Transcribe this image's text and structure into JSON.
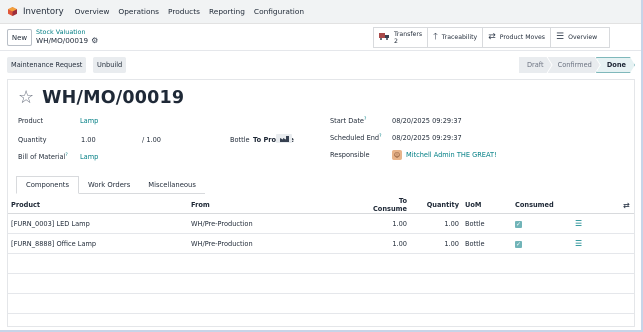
{
  "nav": {
    "brand": "Inventory",
    "items": [
      "Overview",
      "Operations",
      "Products",
      "Reporting",
      "Configuration"
    ]
  },
  "control": {
    "new_label": "New",
    "breadcrumb_parent": "Stock Valuation",
    "breadcrumb_current": "WH/MO/00019"
  },
  "smart_buttons": {
    "transfers_label": "Transfers",
    "transfers_count": "2",
    "traceability": "Traceability",
    "product_moves": "Product Moves",
    "overview": "Overview"
  },
  "status": {
    "maintenance": "Maintenance Request",
    "unbuild": "Unbuild",
    "steps": [
      "Draft",
      "Confirmed",
      "Done"
    ],
    "active_step": "Done"
  },
  "record": {
    "title": "WH/MO/00019",
    "product_label": "Product",
    "product_value": "Lamp",
    "quantity_label": "Quantity",
    "quantity_value": "1.00",
    "quantity_of": "/ 1.00",
    "bottle_text": "Bottle",
    "to_produce": "To Produce",
    "bom_label": "Bill of Material",
    "bom_value": "Lamp",
    "start_label": "Start Date",
    "start_value": "08/20/2025 09:29:37",
    "sched_label": "Scheduled End",
    "sched_value": "08/20/2025 09:29:37",
    "resp_label": "Responsible",
    "resp_value": "Mitchell Admin THE GREAT!",
    "help_mark": "?"
  },
  "tabs": [
    "Components",
    "Work Orders",
    "Miscellaneous"
  ],
  "table": {
    "headers": {
      "product": "Product",
      "from": "From",
      "to_consume": "To Consume",
      "quantity": "Quantity",
      "uom": "UoM",
      "consumed": "Consumed"
    },
    "rows": [
      {
        "product": "[FURN_0003] LED Lamp",
        "from": "WH/Pre-Production",
        "to_consume": "1.00",
        "quantity": "1.00",
        "uom": "Bottle"
      },
      {
        "product": "[FURN_8888] Office Lamp",
        "from": "WH/Pre-Production",
        "to_consume": "1.00",
        "quantity": "1.00",
        "uom": "Bottle"
      }
    ]
  },
  "colors": {
    "accent": "#017e84",
    "app_icon": "#e0563a"
  },
  "icons": {
    "app": "inventory-icon",
    "gear": "gear-icon",
    "truck": "truck-icon",
    "arrow_up": "arrow-up-icon",
    "exchange": "exchange-icon",
    "list": "list-icon",
    "star": "star-icon",
    "settings": "column-settings-icon"
  }
}
